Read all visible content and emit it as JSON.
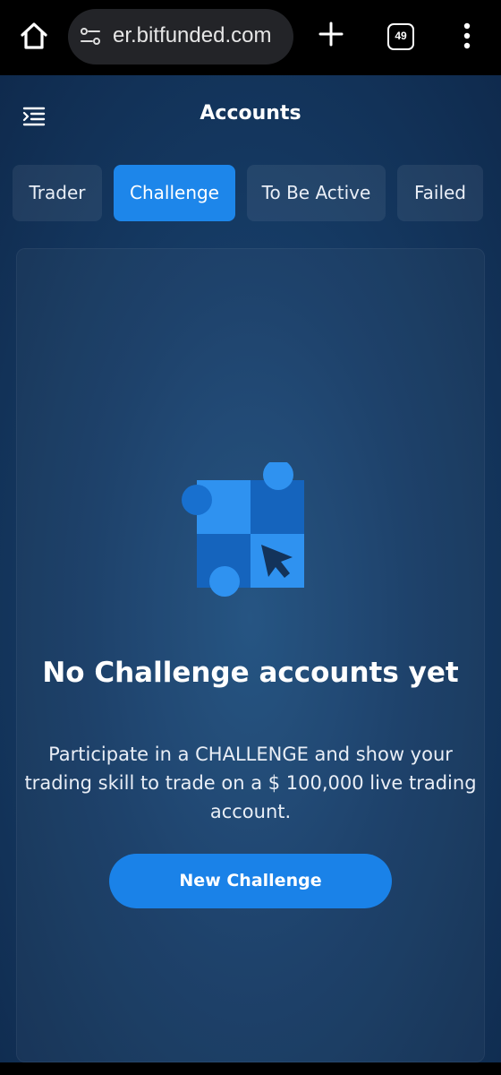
{
  "browser": {
    "url": "er.bitfunded.com",
    "tab_count": "49",
    "icons": [
      "home-icon",
      "site-settings-icon",
      "new-tab-icon",
      "tab-switcher-icon",
      "more-vert-icon"
    ]
  },
  "header": {
    "title": "Accounts",
    "menu_icon": "sidebar-menu-icon"
  },
  "tabs": [
    {
      "label": "Trader",
      "active": false
    },
    {
      "label": "Challenge",
      "active": true
    },
    {
      "label": "To Be Active",
      "active": false
    },
    {
      "label": "Failed",
      "active": false
    }
  ],
  "empty_state": {
    "icon": "challenge-empty-illustration",
    "title": "No Challenge accounts yet",
    "description": "Participate in a CHALLENGE and show your trading skill to trade on a $ 100,000 live trading account.",
    "button_label": "New Challenge"
  },
  "colors": {
    "accent": "#1d86ea",
    "background_top": "#0f2a4d",
    "background_center": "#1f4f7f"
  }
}
